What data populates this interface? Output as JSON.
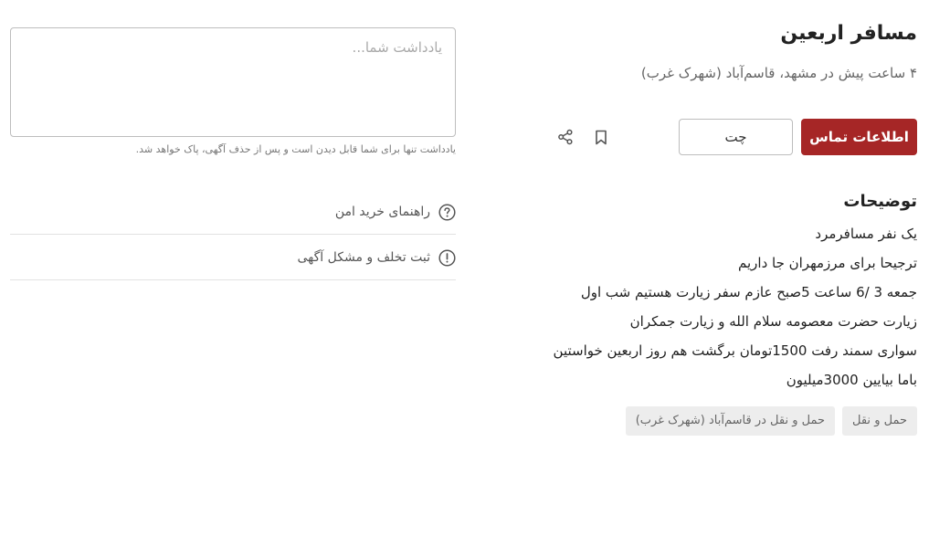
{
  "ad": {
    "title": "مسافر اربعین",
    "subtitle": "۴ ساعت پیش در مشهد، قاسم‌آباد (شهرک غرب)"
  },
  "actions": {
    "contact_label": "اطلاعات تماس",
    "chat_label": "چت",
    "bookmark_icon": "bookmark-icon",
    "share_icon": "share-icon"
  },
  "description": {
    "heading": "توضیحات",
    "lines": [
      "یک نفر مسافرمرد",
      "ترجیحا برای مرزمهران جا داریم",
      "جمعه 3 /6 ساعت 5صبح عازم سفر زیارت هستیم شب اول",
      "زیارت حضرت معصومه سلام الله و زیارت جمکران",
      "سواری سمند رفت 1500تومان برگشت هم روز اربعین خواستین",
      "باما بیایین 3000میلیون"
    ]
  },
  "tags": [
    "حمل و نقل",
    "حمل و نقل در قاسم‌آباد (شهرک غرب)"
  ],
  "note": {
    "placeholder": "یادداشت شما...",
    "value": "",
    "hint": "یادداشت تنها برای شما قابل دیدن است و پس از حذف آگهی، پاک خواهد شد."
  },
  "links": [
    {
      "label": "راهنمای خرید امن",
      "icon": "question-circle-icon"
    },
    {
      "label": "ثبت تخلف و مشکل آگهی",
      "icon": "exclamation-circle-icon"
    }
  ],
  "colors": {
    "primary": "#a62626",
    "chip_bg": "#ededed",
    "muted_text": "#666666"
  }
}
